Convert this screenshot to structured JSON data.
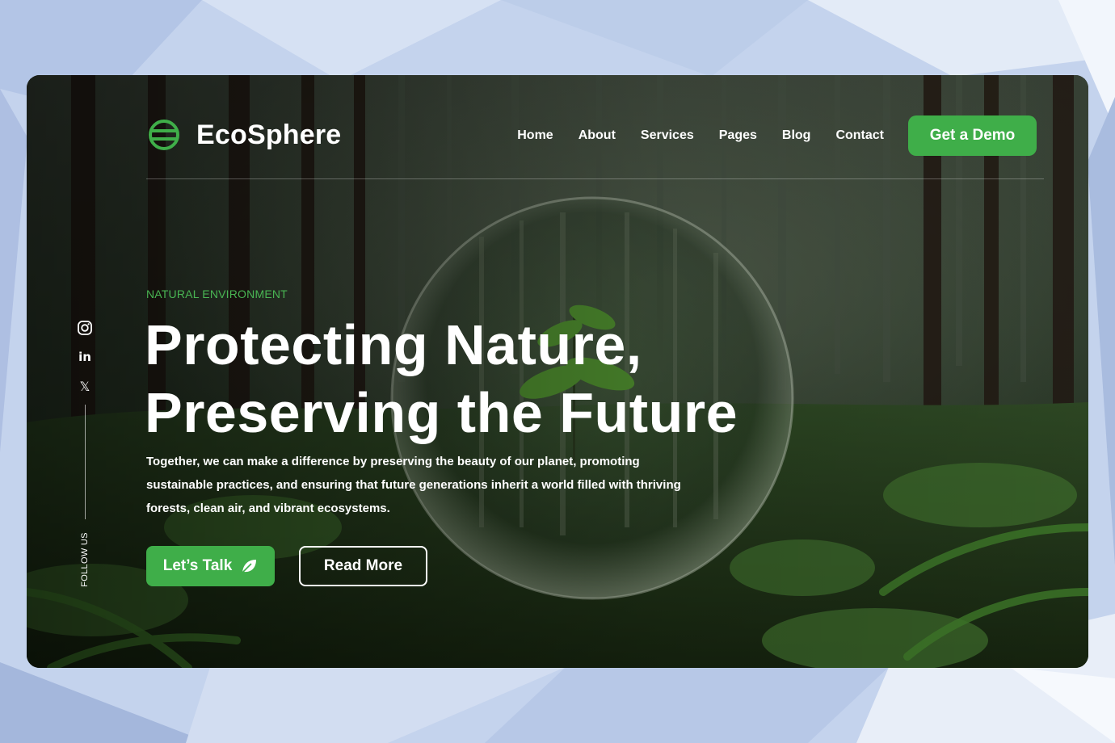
{
  "brand": {
    "name": "EcoSphere",
    "icon": "globe-icon",
    "accent": "#3fae49"
  },
  "nav": {
    "items": [
      "Home",
      "About",
      "Services",
      "Pages",
      "Blog",
      "Contact"
    ],
    "cta": "Get a Demo"
  },
  "social": {
    "icons": [
      "instagram-icon",
      "linkedin-icon",
      "x-icon"
    ],
    "follow_label": "FOLLOW US"
  },
  "hero": {
    "eyebrow": "NATURAL ENVIRONMENT",
    "headline_line1": "Protecting Nature,",
    "headline_line2": "Preserving the Future",
    "description": "Together, we can make a difference by preserving the beauty of our planet, promoting sustainable practices, and ensuring that future generations inherit a world filled with thriving forests, clean air, and vibrant ecosystems.",
    "primary_button": "Let’s Talk",
    "primary_icon": "leaf-icon",
    "secondary_button": "Read More"
  }
}
